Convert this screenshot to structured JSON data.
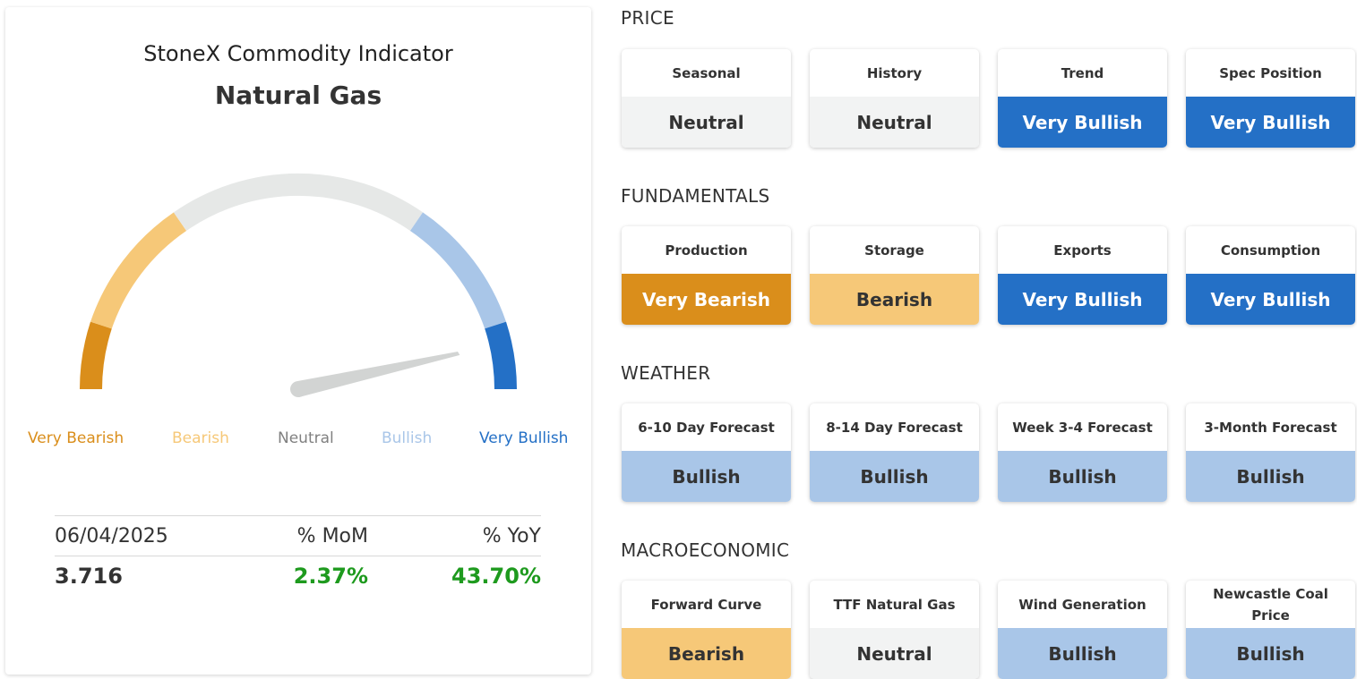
{
  "indicator": {
    "subtitle": "StoneX Commodity Indicator",
    "commodity": "Natural Gas",
    "gauge_level": 0.93,
    "scale_labels": [
      {
        "label": "Very Bearish",
        "color": "#da8e1b"
      },
      {
        "label": "Bearish",
        "color": "#f6c878"
      },
      {
        "label": "Neutral",
        "color": "#808080"
      },
      {
        "label": "Bullish",
        "color": "#a9c6e8"
      },
      {
        "label": "Very Bullish",
        "color": "#2470c6"
      }
    ],
    "stats": {
      "date": "06/04/2025",
      "mom_label": "% MoM",
      "yoy_label": "% YoY",
      "price": "3.716",
      "mom_value": "2.37%",
      "yoy_value": "43.70%"
    }
  },
  "sections": [
    {
      "title": "PRICE",
      "tiles": [
        {
          "label": "Seasonal",
          "status": "Neutral"
        },
        {
          "label": "History",
          "status": "Neutral"
        },
        {
          "label": "Trend",
          "status": "Very Bullish"
        },
        {
          "label": "Spec Position",
          "status": "Very Bullish"
        }
      ]
    },
    {
      "title": "FUNDAMENTALS",
      "tiles": [
        {
          "label": "Production",
          "status": "Very Bearish"
        },
        {
          "label": "Storage",
          "status": "Bearish"
        },
        {
          "label": "Exports",
          "status": "Very Bullish"
        },
        {
          "label": "Consumption",
          "status": "Very Bullish"
        }
      ]
    },
    {
      "title": "WEATHER",
      "tiles": [
        {
          "label": "6-10 Day Forecast",
          "status": "Bullish"
        },
        {
          "label": "8-14 Day Forecast",
          "status": "Bullish"
        },
        {
          "label": "Week 3-4 Forecast",
          "status": "Bullish"
        },
        {
          "label": "3-Month Forecast",
          "status": "Bullish"
        }
      ]
    },
    {
      "title": "MACROECONOMIC",
      "tiles": [
        {
          "label": "Forward Curve",
          "status": "Bearish"
        },
        {
          "label": "TTF Natural Gas",
          "status": "Neutral"
        },
        {
          "label": "Wind Generation",
          "status": "Bullish"
        },
        {
          "label": "Newcastle Coal Price",
          "status": "Bullish"
        }
      ]
    }
  ],
  "colors": {
    "very_bearish": "#da8e1b",
    "bearish": "#f6c878",
    "neutral": "#f2f3f3",
    "bullish": "#a9c6e8",
    "very_bullish": "#2470c6",
    "positive_change": "#1e9a1e"
  }
}
